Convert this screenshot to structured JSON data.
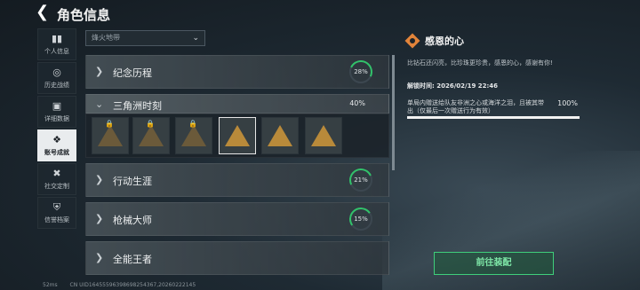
{
  "header": {
    "title": "角色信息"
  },
  "sidebar": {
    "items": [
      {
        "icon": "bar-chart-icon",
        "label": "个人信息"
      },
      {
        "icon": "target-icon",
        "label": "历史战绩"
      },
      {
        "icon": "document-icon",
        "label": "详细数据"
      },
      {
        "icon": "medal-icon",
        "label": "账号成就",
        "active": true
      },
      {
        "icon": "tools-icon",
        "label": "社交定制"
      },
      {
        "icon": "shield-icon",
        "label": "信誉档案"
      }
    ]
  },
  "filter": {
    "value": "烽火地带"
  },
  "list": {
    "rows": [
      {
        "name": "纪念历程",
        "percent": "28%",
        "expanded": false
      },
      {
        "name": "三角洲时刻",
        "percent": "40%",
        "expanded": true
      },
      {
        "name": "行动生涯",
        "percent": "21%",
        "expanded": false
      },
      {
        "name": "枪械大师",
        "percent": "15%",
        "expanded": false
      },
      {
        "name": "全能王者",
        "percent": "",
        "expanded": false
      }
    ],
    "badges": [
      {
        "name": "badge-1",
        "locked": true
      },
      {
        "name": "badge-2",
        "locked": true
      },
      {
        "name": "badge-3",
        "locked": true
      },
      {
        "name": "badge-4",
        "locked": false,
        "selected": true
      },
      {
        "name": "badge-5",
        "locked": false
      },
      {
        "name": "badge-6",
        "locked": false
      }
    ]
  },
  "detail": {
    "title": "感恩的心",
    "description": "比钻石还闪亮，比珍珠更珍贵，感恩的心，感谢有你!",
    "time": "解锁时间: 2026/02/19 22:46",
    "task": "单局内赠送给队友非洲之心或海洋之泪，且被其带出（仅最后一次赠送行为有效）",
    "task_percent": "100%",
    "progress": 1.0
  },
  "equip_button": "前往装配",
  "footer": {
    "ping": "52ms",
    "uid": "CN UID16455596398698254367,20260222145"
  },
  "colors": {
    "accent_green": "#31c26a",
    "badge_gold": "#b98a3a",
    "detail_icon": "#e2843a"
  }
}
